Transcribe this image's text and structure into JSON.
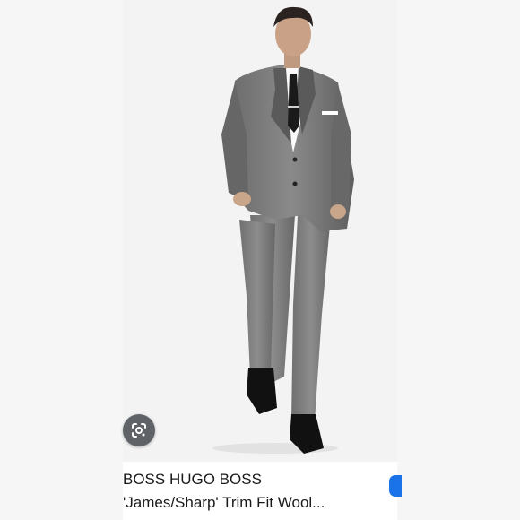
{
  "product": {
    "brand": "BOSS HUGO BOSS",
    "title": "'James/Sharp' Trim Fit Wool...",
    "image_alt": "Man in gray two-piece suit with black tie"
  },
  "icons": {
    "lens": "google-lens-icon"
  },
  "colors": {
    "suit": "#7a7a7a",
    "background": "#f3f3f3",
    "accent": "#1a73e8",
    "lens_button": "#5f6368"
  }
}
